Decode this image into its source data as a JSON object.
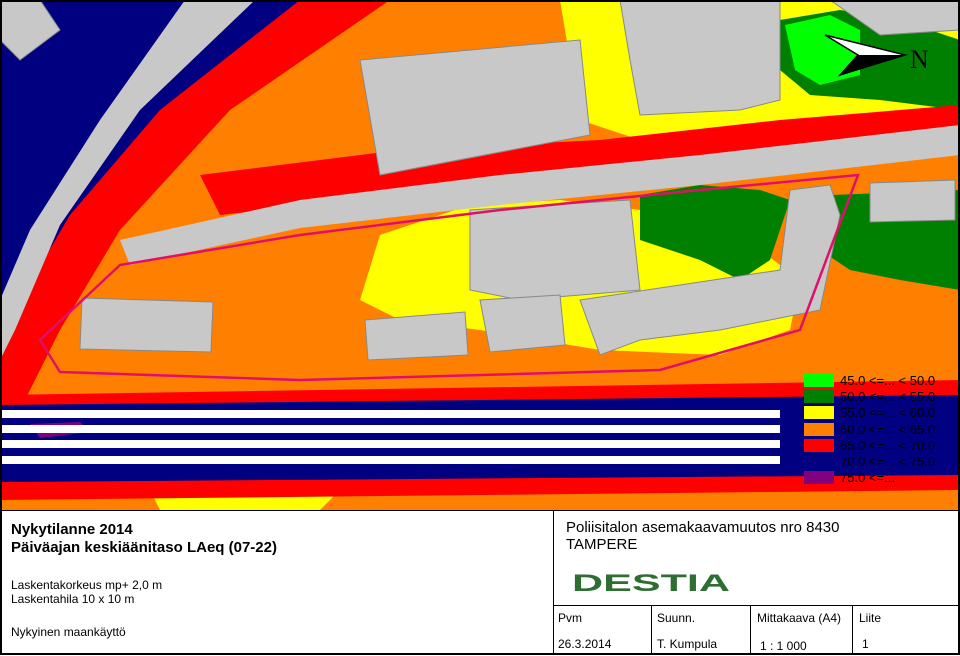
{
  "legend": [
    {
      "label": "45.0 <=... < 50.0",
      "color": "#00ff00"
    },
    {
      "label": "50.0 <=... < 55.0",
      "color": "#008000"
    },
    {
      "label": "55.0 <=... < 60.0",
      "color": "#ffff00"
    },
    {
      "label": "60.0 <=... < 65.0",
      "color": "#ff8000"
    },
    {
      "label": "65.0 <=... < 70.0",
      "color": "#ff0000"
    },
    {
      "label": "70.0 <=... < 75.0",
      "color": "#000080"
    },
    {
      "label": "75.0 <=...",
      "color": "#800080"
    }
  ],
  "north_label": "N",
  "info": {
    "title_line1": "Nykytilanne 2014",
    "title_line2": "Päiväajan keskiäänitaso LAeq (07-22)",
    "calc_height": "Laskentakorkeus mp+ 2,0 m",
    "calc_grid": "Laskentahila 10 x 10 m",
    "land_use": "Nykyinen maankäyttö",
    "project_line1": "Poliisitalon asemakaavamuutos nro 8430",
    "project_line2": "TAMPERE",
    "logo_text": "DESTIA",
    "pvm_label": "Pvm",
    "pvm_value": "26.3.2014",
    "suunn_label": "Suunn.",
    "suunn_value": "T. Kumpula",
    "scale_label": "Mittakaava (A4)",
    "scale_value": "1 : 1 000",
    "liite_label": "Liite",
    "liite_value": "1"
  },
  "colors": {
    "road": "#c8c8c8",
    "building": "#c8c8c8",
    "plan_boundary": "#e0106a",
    "brand": "#2e6e32"
  }
}
